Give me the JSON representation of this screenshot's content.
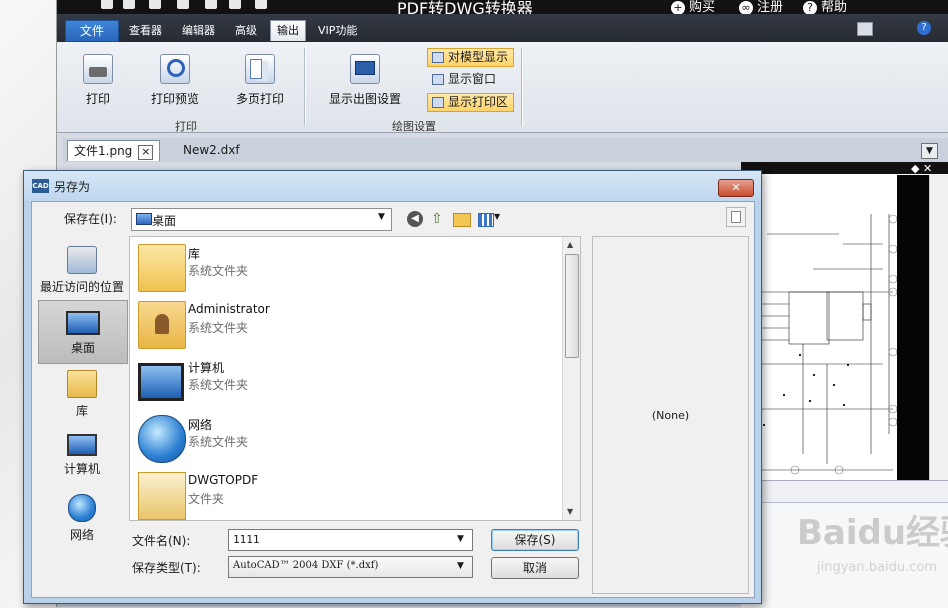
{
  "app": {
    "title": "PDF转DWG转换器",
    "buy_label": "购买",
    "register_label": "注册",
    "help_label": "帮助",
    "tabs": [
      {
        "label": "文件"
      },
      {
        "label": "查看器"
      },
      {
        "label": "编辑器"
      },
      {
        "label": "高级"
      },
      {
        "label": "输出"
      },
      {
        "label": "VIP功能"
      }
    ],
    "ribbon": {
      "print_label": "打印",
      "print_preview_label": "打印预览",
      "multipage_print_label": "多页打印",
      "print_group_label": "打印",
      "display_plot_settings_label": "显示出图设置",
      "display_for_model_label": "对模型显示",
      "display_window_label": "显示窗口",
      "display_print_area_label": "显示打印区",
      "plot_settings_group_label": "绘图设置"
    },
    "doc_tabs": [
      {
        "label": "文件1.png"
      },
      {
        "label": "New2.dxf"
      }
    ]
  },
  "dialog": {
    "title": "另存为",
    "save_in_label": "保存在(I):",
    "save_in_value": "桌面",
    "places": [
      {
        "label": "最近访问的位置",
        "icon": "recent-places-icon"
      },
      {
        "label": "桌面",
        "icon": "desktop-icon"
      },
      {
        "label": "库",
        "icon": "libraries-icon"
      },
      {
        "label": "计算机",
        "icon": "computer-icon"
      },
      {
        "label": "网络",
        "icon": "network-icon"
      }
    ],
    "files": [
      {
        "name": "库",
        "type": "系统文件夹",
        "icon": "libraries-folder-icon"
      },
      {
        "name": "Administrator",
        "type": "系统文件夹",
        "icon": "user-folder-icon"
      },
      {
        "name": "计算机",
        "type": "系统文件夹",
        "icon": "computer-icon"
      },
      {
        "name": "网络",
        "type": "系统文件夹",
        "icon": "network-icon"
      },
      {
        "name": "DWGTOPDF",
        "type": "文件夹",
        "icon": "folder-icon"
      }
    ],
    "preview_text": "(None)",
    "filename_label": "文件名(N):",
    "filename_value": "1111",
    "filetype_label": "保存类型(T):",
    "filetype_value": "AutoCAD™ 2004 DXF (*.dxf)",
    "save_button": "保存(S)",
    "cancel_button": "取消"
  },
  "watermark": {
    "text": "Baidu经验",
    "sub": "jingyan.baidu.com"
  }
}
